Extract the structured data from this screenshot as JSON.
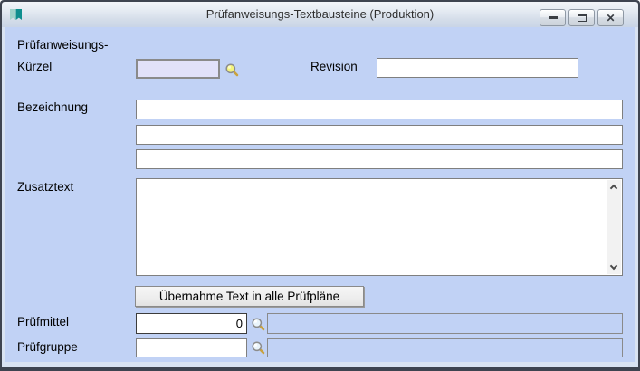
{
  "window": {
    "title": "Prüfanweisungs-Textbausteine (Produktion)",
    "controls": {
      "minimize": "minimize",
      "maximize": "maximize",
      "close": "close"
    }
  },
  "form": {
    "kuerzel": {
      "label_line1": "Prüfanweisungs-",
      "label_line2": "Kürzel",
      "value": ""
    },
    "revision": {
      "label": "Revision",
      "value": ""
    },
    "bezeichnung": {
      "label": "Bezeichnung",
      "lines": [
        "",
        "",
        ""
      ]
    },
    "zusatztext": {
      "label": "Zusatztext",
      "value": ""
    },
    "transfer_button_label": "Übernahme Text in alle Prüfpläne",
    "pruefmittel": {
      "label": "Prüfmittel",
      "value": "0",
      "description": ""
    },
    "pruefgruppe": {
      "label": "Prüfgruppe",
      "value": "",
      "description": ""
    }
  },
  "icons": {
    "app_icon": "double-bookmark-teal",
    "kuerzel_lookup": "magnifier-yellow",
    "pruefmittel_lookup": "magnifier-pale-blue",
    "pruefgruppe_lookup": "magnifier-pale-blue",
    "scroll_up": "chevron-up",
    "scroll_down": "chevron-down"
  },
  "colors": {
    "window_border": "#3E4450",
    "titlebar_top": "#F2F5F9",
    "titlebar_bottom": "#C9D5E6",
    "frame_bg": "#D9E3F2",
    "content_bg": "#C1D2F5",
    "kuerzel_field_bg": "#E1E1F9",
    "disabled_field_bg": "#C1D2F5",
    "field_border": "#7F7F7F",
    "icon_teal_light": "#9ED2CA",
    "icon_teal_dark": "#0E8E8E",
    "magnifier_lens_yellow": "#F3F37E",
    "magnifier_lens_blue": "#EAF4FB",
    "magnifier_handle": "#C9A23F"
  }
}
